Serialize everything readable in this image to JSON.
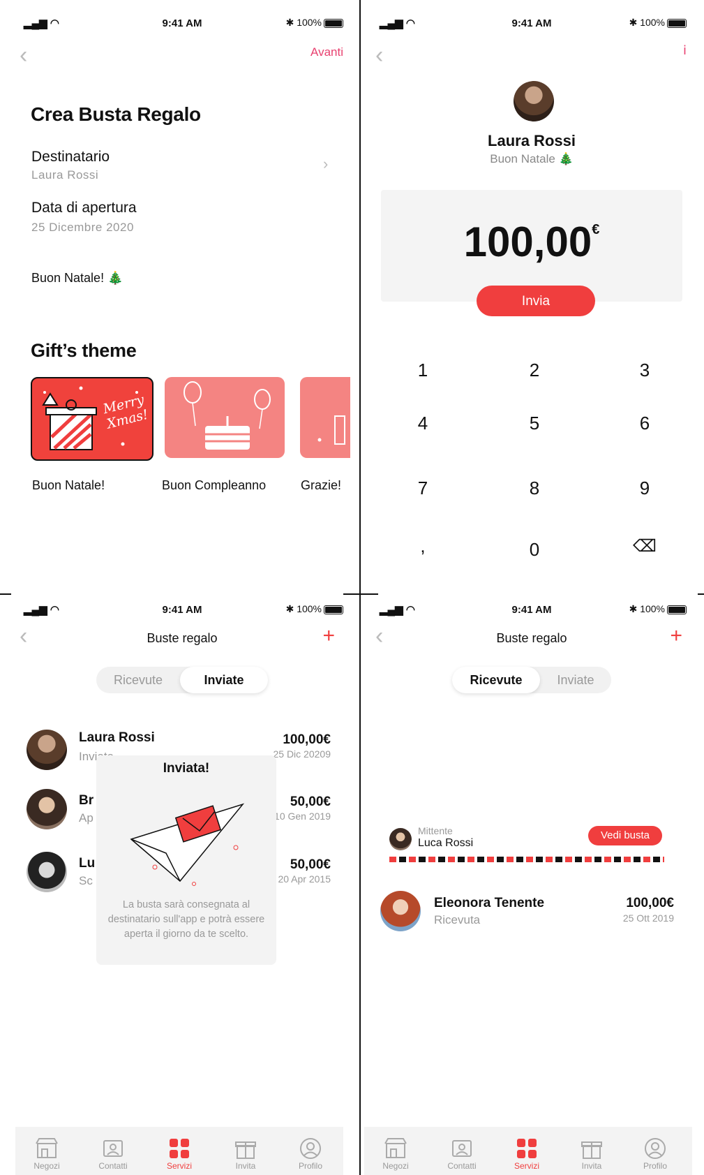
{
  "status": {
    "time": "9:41 AM",
    "battery": "100%",
    "signal": "▐▐ ◠",
    "bt": "✱"
  },
  "screen1": {
    "next_label": "Avanti",
    "title": "Crea Busta Regalo",
    "recipient_label": "Destinatario",
    "recipient_value": "Laura Rossi",
    "date_label": "Data di apertura",
    "date_value": "25 Dicembre 2020",
    "message": "Buon Natale! 🎄",
    "theme_title": "Gift’s theme",
    "themes": [
      "Buon Natale!",
      "Buon Compleanno",
      "Grazie!"
    ],
    "card_text": "Merry Xmas!"
  },
  "screen2": {
    "name": "Laura Rossi",
    "note": "Buon Natale 🎄",
    "amount": "100,00",
    "currency": "€",
    "send_label": "Invia",
    "keys": [
      "1",
      "2",
      "3",
      "4",
      "5",
      "6",
      "7",
      "8",
      "9",
      ",",
      "0",
      "⌫"
    ]
  },
  "screen3": {
    "title": "Buste regalo",
    "seg_received": "Ricevute",
    "seg_sent": "Inviate",
    "rows": [
      {
        "name": "Laura Rossi",
        "status": "Inviata",
        "amount": "100,00€",
        "date": "25 Dic 20209"
      },
      {
        "name": "Br",
        "status": "Ap",
        "amount": "50,00€",
        "date": "10 Gen 2019"
      },
      {
        "name": "Lu",
        "status": "Sc",
        "amount": "50,00€",
        "date": "20 Apr 2015"
      }
    ],
    "modal_title": "Inviata!",
    "modal_body": "La busta sarà consegnata al destinatario sull'app e potrà essere aperta il giorno da te scelto."
  },
  "screen4": {
    "title": "Buste regalo",
    "seg_received": "Ricevute",
    "seg_sent": "Inviate",
    "sender_label": "Mittente",
    "sender_name": "Luca Rossi",
    "open_label": "Vedi busta",
    "row": {
      "name": "Eleonora Tenente",
      "status": "Ricevuta",
      "amount": "100,00€",
      "date": "25 Ott 2019"
    }
  },
  "tabbar": [
    "Negozi",
    "Contatti",
    "Servizi",
    "Invita",
    "Profilo"
  ],
  "colors": {
    "accent": "#f03e3e",
    "pink": "#e8406f",
    "card": "#f48482"
  }
}
